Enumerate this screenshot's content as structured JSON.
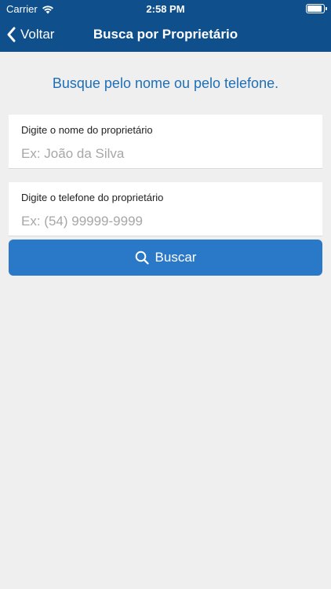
{
  "status_bar": {
    "carrier": "Carrier",
    "time": "2:58 PM"
  },
  "nav": {
    "back_label": "Voltar",
    "title": "Busca por Proprietário"
  },
  "main": {
    "subtitle": "Busque pelo nome ou pelo telefone.",
    "name_field": {
      "label": "Digite o nome do proprietário",
      "placeholder": "Ex: João da Silva",
      "value": ""
    },
    "phone_field": {
      "label": "Digite o telefone do proprietário",
      "placeholder": "Ex: (54) 99999-9999",
      "value": ""
    },
    "search_button": {
      "label": "Buscar",
      "icon": "search-icon"
    }
  },
  "colors": {
    "header_bg": "#0e4f8c",
    "accent": "#2a78c8",
    "subtitle": "#1f6fb5",
    "page_bg": "#efefef"
  }
}
